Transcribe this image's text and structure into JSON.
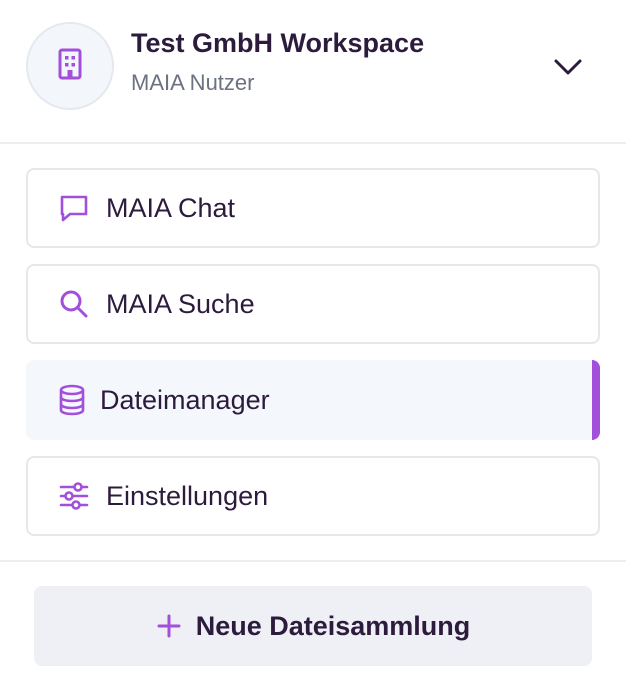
{
  "workspace": {
    "name": "Test GmbH Workspace",
    "role": "MAIA Nutzer",
    "icon": "building-icon"
  },
  "nav": {
    "items": [
      {
        "label": "MAIA Chat",
        "icon": "chat-bubble-icon",
        "active": false
      },
      {
        "label": "MAIA Suche",
        "icon": "search-icon",
        "active": false
      },
      {
        "label": "Dateimanager",
        "icon": "database-icon",
        "active": true
      },
      {
        "label": "Einstellungen",
        "icon": "sliders-icon",
        "active": false
      }
    ]
  },
  "new_collection": {
    "label": "Neue Dateisammlung",
    "icon": "plus-icon"
  },
  "colors": {
    "accent": "#a24fdb",
    "text": "#2d1b3d",
    "muted": "#6b7280",
    "active_bg": "#f4f7fc",
    "button_bg": "#eef0f5"
  }
}
